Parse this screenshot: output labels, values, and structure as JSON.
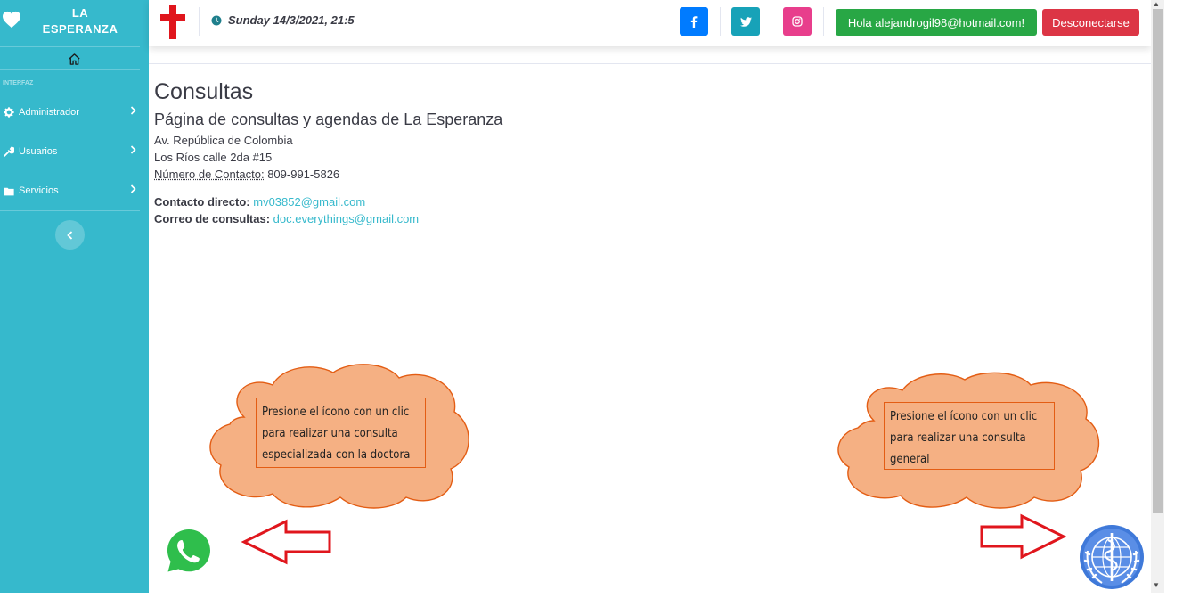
{
  "brand": {
    "line1": "LA",
    "line2": "ESPERANZA",
    "icon": "heart-icon"
  },
  "sidebar": {
    "section_heading": "INTERFAZ",
    "items": [
      {
        "label": "Administrador",
        "icon": "gear-icon"
      },
      {
        "label": "Usuarios",
        "icon": "wrench-icon"
      },
      {
        "label": "Servicios",
        "icon": "folder-icon"
      }
    ]
  },
  "topbar": {
    "datetime": "Sunday 14/3/2021, 21:5",
    "greeting_button": "Hola alejandrogil98@hotmail.com!",
    "logout_button": "Desconectarse",
    "social": [
      {
        "name": "facebook",
        "color": "#007bff"
      },
      {
        "name": "twitter",
        "color": "#17a2b8"
      },
      {
        "name": "instagram",
        "color": "#e83e8c"
      }
    ]
  },
  "main": {
    "title": "Consultas",
    "subtitle": "Página de consultas y agendas de La Esperanza",
    "address_line1": "Av. República de Colombia",
    "address_line2": "Los Ríos calle 2da #15",
    "phone_label": "Número de Contacto:",
    "phone_value": " 809-991-5826",
    "direct_contact_label": "Contacto directo:",
    "direct_contact_email": "mv03852@gmail.com",
    "consult_email_label": "Correo de consultas:",
    "consult_email": "doc.everythings@gmail.com"
  },
  "callouts": {
    "left": [
      "Presione el ícono con un clic",
      "para realizar una consulta",
      "especializada con la doctora"
    ],
    "right": [
      "Presione el ícono con un clic",
      "para realizar una consulta",
      "general"
    ]
  },
  "colors": {
    "sidebar": "#36b9cc",
    "success": "#28a745",
    "danger": "#dc3545",
    "cloud": "#f5b083",
    "arrow": "#e0161d"
  }
}
